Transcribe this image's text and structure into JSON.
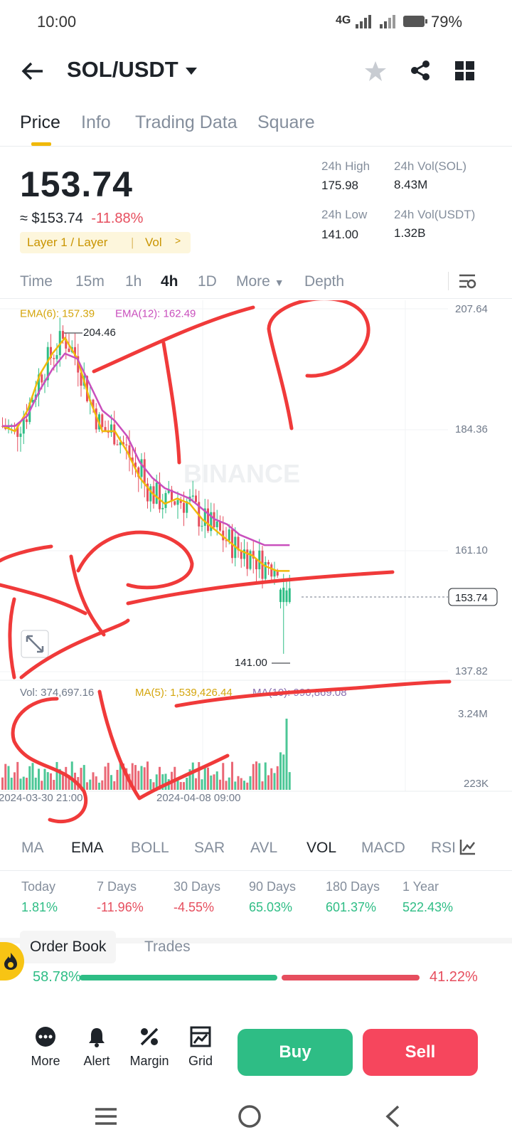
{
  "status_bar": {
    "time": "10:00",
    "network": "4G",
    "battery": "79%"
  },
  "header": {
    "pair": "SOL/USDT"
  },
  "tabs": [
    "Price",
    "Info",
    "Trading Data",
    "Square"
  ],
  "price": {
    "last": "153.74",
    "usd": "≈ $153.74",
    "change": "-11.88%",
    "tag_label": "Layer 1 / Layer",
    "tag_vol": "Vol",
    "high_label": "24h High",
    "high": "175.98",
    "low_label": "24h Low",
    "low": "141.00",
    "vol_sol_label": "24h Vol(SOL)",
    "vol_sol": "8.43M",
    "vol_usdt_label": "24h Vol(USDT)",
    "vol_usdt": "1.32B"
  },
  "intervals": [
    "Time",
    "15m",
    "1h",
    "4h",
    "1D",
    "More",
    "Depth"
  ],
  "active_interval": "4h",
  "chart": {
    "ema6_label": "EMA(6): 157.39",
    "ema12_label": "EMA(12): 162.49",
    "y_ticks": [
      "207.64",
      "184.36",
      "161.10",
      "137.82"
    ],
    "high_marker": "204.46",
    "low_marker": "141.00",
    "current_price_tag": "153.74",
    "vol_label": "Vol: 374,697.16",
    "ma5_label": "MA(5): 1,539,426.44",
    "ma10_label": "MA(10): 990,869.08",
    "vol_ticks": [
      "3.24M",
      "223K"
    ],
    "x_ticks": [
      "2024-03-30 21:00",
      "2024-04-08 09:00"
    ],
    "watermark": "BINANCE",
    "colors": {
      "up": "#2ebd85",
      "down": "#e64e5e",
      "ema6": "#f0b90b",
      "ema12": "#c94fbd",
      "ink": "#f03a3a"
    }
  },
  "chart_data": {
    "type": "candlestick",
    "series": [
      {
        "name": "EMA(6)",
        "values": [
          185,
          184,
          188,
          195,
          199,
          202,
          198,
          190,
          184,
          184,
          180,
          175,
          172,
          170,
          171,
          170,
          167,
          165,
          163,
          161,
          160,
          158,
          157,
          157
        ]
      },
      {
        "name": "EMA(12)",
        "values": [
          185,
          185,
          187,
          192,
          196,
          199,
          198,
          193,
          188,
          186,
          183,
          178,
          175,
          173,
          172,
          171,
          169,
          167,
          166,
          164,
          163,
          162,
          162,
          162
        ]
      }
    ],
    "ylim": [
      137.82,
      207.64
    ],
    "high": 204.46,
    "low": 141.0,
    "last": 153.74
  },
  "indicators": [
    "MA",
    "EMA",
    "BOLL",
    "SAR",
    "AVL",
    "VOL",
    "MACD",
    "RSI"
  ],
  "performance": [
    {
      "label": "Today",
      "value": "1.81%"
    },
    {
      "label": "7 Days",
      "value": "-11.96%"
    },
    {
      "label": "30 Days",
      "value": "-4.55%"
    },
    {
      "label": "90 Days",
      "value": "65.03%"
    },
    {
      "label": "180 Days",
      "value": "601.37%"
    },
    {
      "label": "1 Year",
      "value": "522.43%"
    }
  ],
  "orderbook": {
    "tab1": "Order Book",
    "tab2": "Trades",
    "buy_pct": "58.78%",
    "sell_pct": "41.22%",
    "buy_ratio": 0.5878
  },
  "bottom_nav": {
    "more": "More",
    "alert": "Alert",
    "margin": "Margin",
    "grid": "Grid",
    "buy": "Buy",
    "sell": "Sell"
  }
}
